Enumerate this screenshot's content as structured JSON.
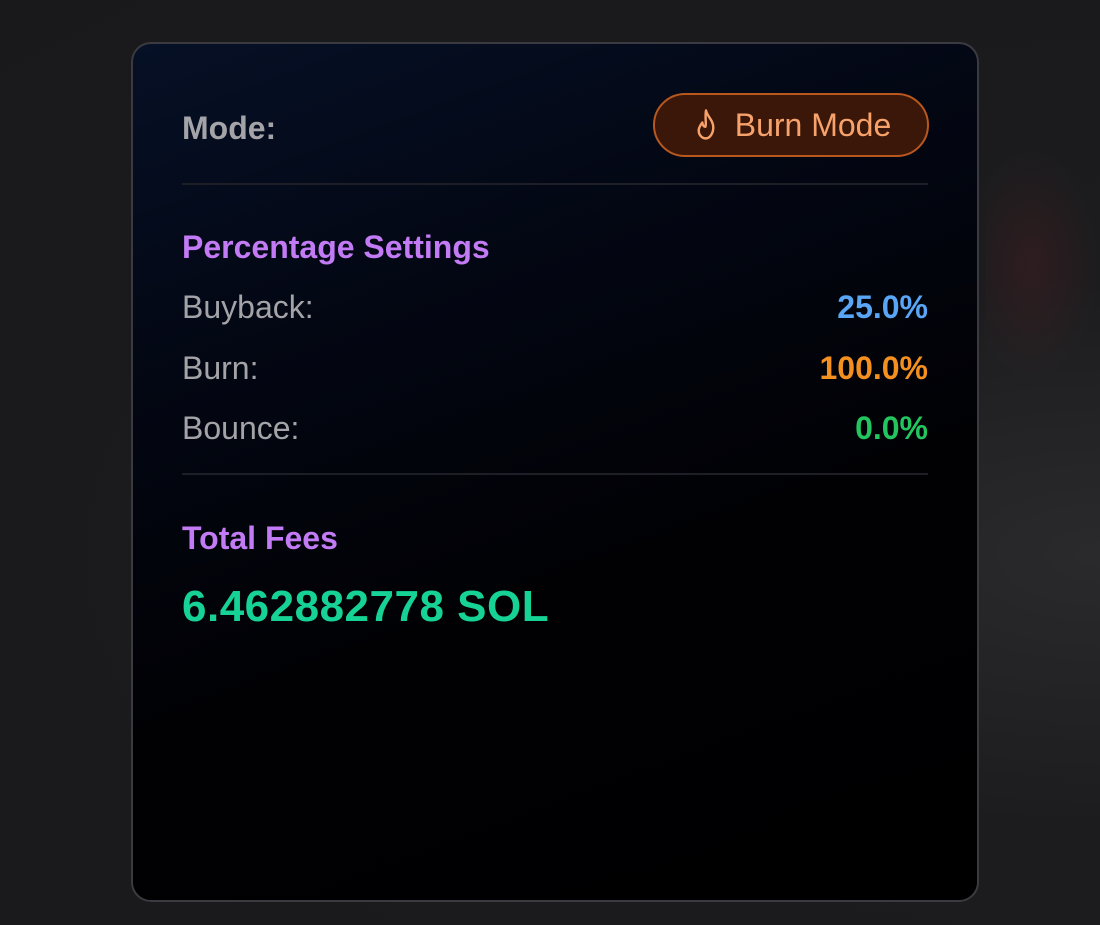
{
  "mode": {
    "label": "Mode:",
    "badge_label": "Burn Mode",
    "badge_icon": "flame-icon",
    "badge_color": "#f7a26b"
  },
  "percentage_settings": {
    "title": "Percentage Settings",
    "rows": [
      {
        "label": "Buyback:",
        "value": "25.0%",
        "color": "#58a6f5"
      },
      {
        "label": "Burn:",
        "value": "100.0%",
        "color": "#f3901f"
      },
      {
        "label": "Bounce:",
        "value": "0.0%",
        "color": "#22c55e"
      }
    ]
  },
  "total_fees": {
    "title": "Total Fees",
    "value": "6.462882778 SOL",
    "color": "#17d295"
  },
  "colors": {
    "section_title": "#c27af5",
    "label": "#a4a4a8"
  }
}
